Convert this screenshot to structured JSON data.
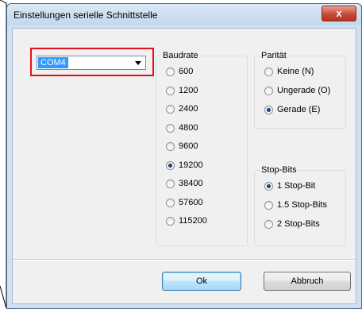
{
  "window": {
    "title": "Einstellungen serielle Schnittstelle",
    "close_label": "x"
  },
  "port": {
    "selected": "COM4"
  },
  "baudrate": {
    "label": "Baudrate",
    "options": [
      "600",
      "1200",
      "2400",
      "4800",
      "9600",
      "19200",
      "38400",
      "57600",
      "115200"
    ],
    "selected": "19200"
  },
  "parity": {
    "label": "Parität",
    "options": [
      "Keine (N)",
      "Ungerade (O)",
      "Gerade (E)"
    ],
    "selected": "Gerade (E)"
  },
  "stopbits": {
    "label": "Stop-Bits",
    "options": [
      "1 Stop-Bit",
      "1.5 Stop-Bits",
      "2 Stop-Bits"
    ],
    "selected": "1 Stop-Bit"
  },
  "buttons": {
    "ok": "Ok",
    "cancel": "Abbruch"
  },
  "colors": {
    "accent": "#3399ff",
    "highlight": "#e3101a"
  }
}
